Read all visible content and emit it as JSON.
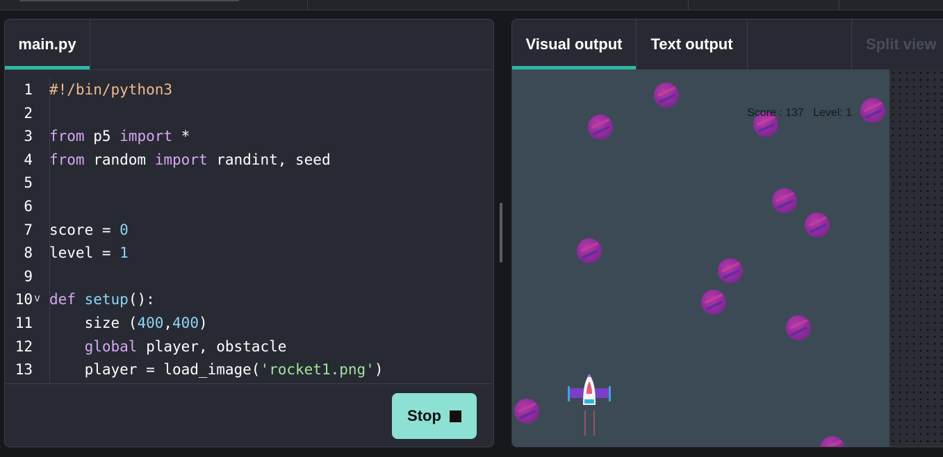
{
  "editor": {
    "tabs": [
      {
        "label": "main.py",
        "active": true
      }
    ],
    "lines": [
      {
        "n": "1",
        "tokens": [
          {
            "t": "#!/bin/python3",
            "c": "meta"
          }
        ]
      },
      {
        "n": "2",
        "tokens": []
      },
      {
        "n": "3",
        "tokens": [
          {
            "t": "from",
            "c": "kw"
          },
          {
            "t": " p5 ",
            "c": "plain"
          },
          {
            "t": "import",
            "c": "kw"
          },
          {
            "t": " *",
            "c": "plain"
          }
        ]
      },
      {
        "n": "4",
        "tokens": [
          {
            "t": "from",
            "c": "kw"
          },
          {
            "t": " random ",
            "c": "plain"
          },
          {
            "t": "import",
            "c": "kw"
          },
          {
            "t": " randint, seed",
            "c": "plain"
          }
        ]
      },
      {
        "n": "5",
        "tokens": []
      },
      {
        "n": "6",
        "tokens": []
      },
      {
        "n": "7",
        "tokens": [
          {
            "t": "score = ",
            "c": "plain"
          },
          {
            "t": "0",
            "c": "num"
          }
        ]
      },
      {
        "n": "8",
        "tokens": [
          {
            "t": "level = ",
            "c": "plain"
          },
          {
            "t": "1",
            "c": "num"
          }
        ]
      },
      {
        "n": "9",
        "tokens": []
      },
      {
        "n": "10",
        "fold": true,
        "tokens": [
          {
            "t": "def",
            "c": "kw"
          },
          {
            "t": " ",
            "c": "plain"
          },
          {
            "t": "setup",
            "c": "fn"
          },
          {
            "t": "():",
            "c": "plain"
          }
        ]
      },
      {
        "n": "11",
        "tokens": [
          {
            "t": "    size (",
            "c": "plain"
          },
          {
            "t": "400",
            "c": "num"
          },
          {
            "t": ",",
            "c": "plain"
          },
          {
            "t": "400",
            "c": "num"
          },
          {
            "t": ")",
            "c": "plain"
          }
        ]
      },
      {
        "n": "12",
        "tokens": [
          {
            "t": "    ",
            "c": "plain"
          },
          {
            "t": "global",
            "c": "kw"
          },
          {
            "t": " player, obstacle",
            "c": "plain"
          }
        ]
      },
      {
        "n": "13",
        "tokens": [
          {
            "t": "    player = load_image(",
            "c": "plain"
          },
          {
            "t": "'rocket1.png'",
            "c": "str"
          },
          {
            "t": ")",
            "c": "plain"
          }
        ]
      }
    ],
    "fold_icon": "chevron-down-icon",
    "stop_label": "Stop",
    "stop_icon": "stop-square-icon"
  },
  "output": {
    "tabs": [
      {
        "label": "Visual output",
        "active": true
      },
      {
        "label": "Text output",
        "active": false
      },
      {
        "label": "Split view",
        "disabled": true
      }
    ],
    "hud": "Score : 137   Level: 1",
    "colors": {
      "canvas": "#3c4a55",
      "accent": "#2fb5a5",
      "stop_button": "#8de0d4",
      "obstacle": "#8c2b9a"
    },
    "obstacle_icon": "planet-icon",
    "player_icon": "rocket-icon"
  }
}
